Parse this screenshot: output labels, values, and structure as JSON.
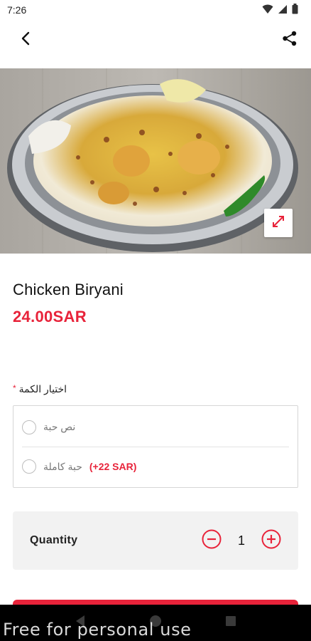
{
  "status_bar": {
    "time": "7:26",
    "icons": [
      "wifi-icon",
      "signal-icon",
      "battery-icon"
    ]
  },
  "app_bar": {
    "back_icon": "arrow-back-icon",
    "share_icon": "share-icon"
  },
  "product": {
    "image_alt": "Chicken Biryani plate",
    "expand_icon": "expand-icon",
    "name": "Chicken Biryani",
    "price": "24.00SAR"
  },
  "options": {
    "title": "اختيار الكمة",
    "required_marker": "*",
    "items": [
      {
        "label": "نص حبة",
        "extra": ""
      },
      {
        "label": "حبة كاملة",
        "extra": "(+22 SAR)"
      }
    ]
  },
  "quantity": {
    "label": "Quantity",
    "value": "1",
    "decrement_icon": "minus-circle-icon",
    "increment_icon": "plus-circle-icon"
  },
  "navigation": {
    "icons": [
      "nav-back-icon",
      "nav-home-icon",
      "nav-recents-icon"
    ]
  },
  "watermark": "Free for personal use",
  "colors": {
    "accent": "#e8233a",
    "qty_background": "#f2f2f2",
    "nav_bar": "#000000"
  }
}
